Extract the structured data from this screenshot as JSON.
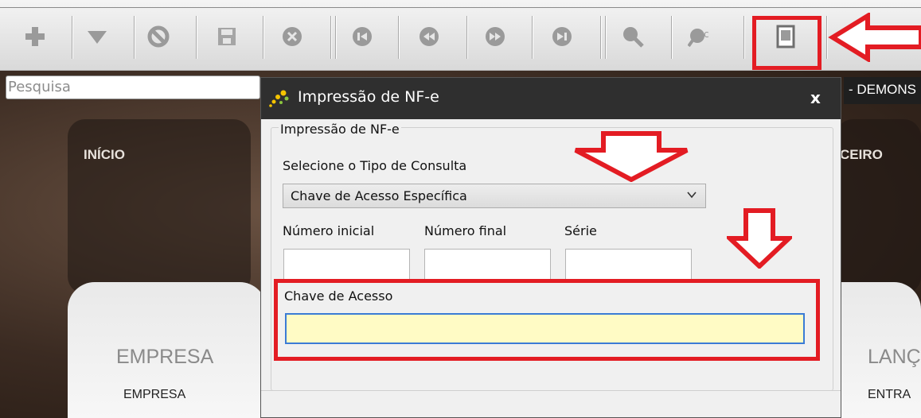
{
  "toolbar": {
    "buttons": [
      {
        "name": "add-icon"
      },
      {
        "name": "dropdown-icon"
      },
      {
        "name": "cancel-icon"
      },
      {
        "name": "save-icon"
      },
      {
        "name": "delete-icon"
      },
      {
        "name": "first-record-icon"
      },
      {
        "name": "previous-record-icon"
      },
      {
        "name": "next-record-icon"
      },
      {
        "name": "last-record-icon"
      },
      {
        "name": "search-icon"
      },
      {
        "name": "advanced-search-icon"
      },
      {
        "name": "print-document-icon"
      }
    ],
    "highlight_color": "#e31c23"
  },
  "search": {
    "placeholder": "Pesquisa"
  },
  "background": {
    "menu": {
      "inicio": "INÍCIO",
      "financeiro": "CEIRO"
    },
    "sections": {
      "left_title": "EMPRESA",
      "left_item": "EMPRESA",
      "right_title": "LANÇ",
      "right_item": "ENTRA"
    },
    "header_right": "- DEMONS"
  },
  "dialog": {
    "title": "Impressão de NF-e",
    "close": "x",
    "group_legend": "Impressão de NF-e",
    "consulta_label": "Selecione o Tipo de Consulta",
    "consulta_value": "Chave de Acesso Específica",
    "numero_inicial_label": "Número inicial",
    "numero_final_label": "Número final",
    "serie_label": "Série",
    "chave_label": "Chave de Acesso",
    "chave_value": ""
  },
  "annotation_color": "#e31c23"
}
